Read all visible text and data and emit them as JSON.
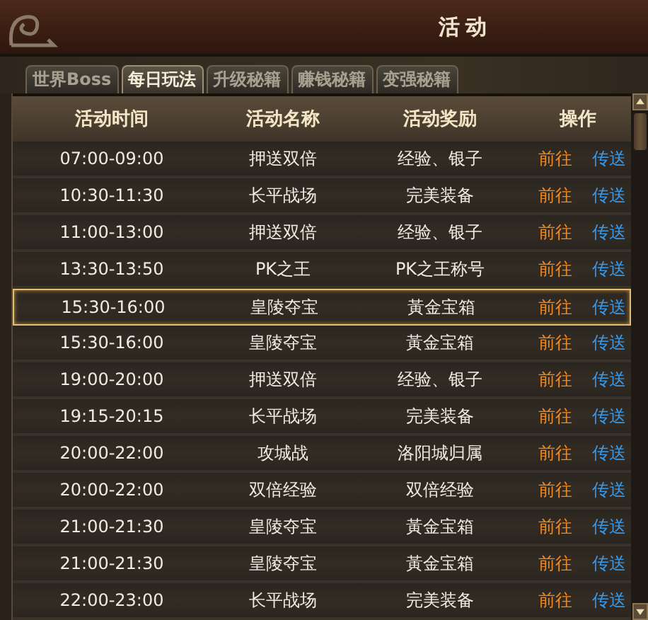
{
  "window": {
    "title": "活动"
  },
  "tabs": [
    {
      "label": "世界Boss",
      "selected": false
    },
    {
      "label": "每日玩法",
      "selected": true
    },
    {
      "label": "升级秘籍",
      "selected": false
    },
    {
      "label": "赚钱秘籍",
      "selected": false
    },
    {
      "label": "变强秘籍",
      "selected": false
    }
  ],
  "table": {
    "columns": [
      "活动时间",
      "活动名称",
      "活动奖励",
      "操作"
    ],
    "rows": [
      {
        "time": "07:00-09:00",
        "name": "押送双倍",
        "reward": "经验、银子",
        "go": "前往",
        "teleport": "传送",
        "selected": false
      },
      {
        "time": "10:30-11:30",
        "name": "长平战场",
        "reward": "完美装备",
        "go": "前往",
        "teleport": "传送",
        "selected": false
      },
      {
        "time": "11:00-13:00",
        "name": "押送双倍",
        "reward": "经验、银子",
        "go": "前往",
        "teleport": "传送",
        "selected": false
      },
      {
        "time": "13:30-13:50",
        "name": "PK之王",
        "reward": "PK之王称号",
        "go": "前往",
        "teleport": "传送",
        "selected": false
      },
      {
        "time": "15:30-16:00",
        "name": "皇陵夺宝",
        "reward": "黃金宝箱",
        "go": "前往",
        "teleport": "传送",
        "selected": true
      },
      {
        "time": "15:30-16:00",
        "name": "皇陵夺宝",
        "reward": "黃金宝箱",
        "go": "前往",
        "teleport": "传送",
        "selected": false
      },
      {
        "time": "19:00-20:00",
        "name": "押送双倍",
        "reward": "经验、银子",
        "go": "前往",
        "teleport": "传送",
        "selected": false
      },
      {
        "time": "19:15-20:15",
        "name": "长平战场",
        "reward": "完美装备",
        "go": "前往",
        "teleport": "传送",
        "selected": false
      },
      {
        "time": "20:00-22:00",
        "name": "攻城战",
        "reward": "洛阳城归属",
        "go": "前往",
        "teleport": "传送",
        "selected": false
      },
      {
        "time": "20:00-22:00",
        "name": "双倍经验",
        "reward": "双倍经验",
        "go": "前往",
        "teleport": "传送",
        "selected": false
      },
      {
        "time": "21:00-21:30",
        "name": "皇陵夺宝",
        "reward": "黃金宝箱",
        "go": "前往",
        "teleport": "传送",
        "selected": false
      },
      {
        "time": "21:00-21:30",
        "name": "皇陵夺宝",
        "reward": "黃金宝箱",
        "go": "前往",
        "teleport": "传送",
        "selected": false
      },
      {
        "time": "22:00-23:00",
        "name": "长平战场",
        "reward": "完美装备",
        "go": "前往",
        "teleport": "传送",
        "selected": false
      }
    ]
  }
}
